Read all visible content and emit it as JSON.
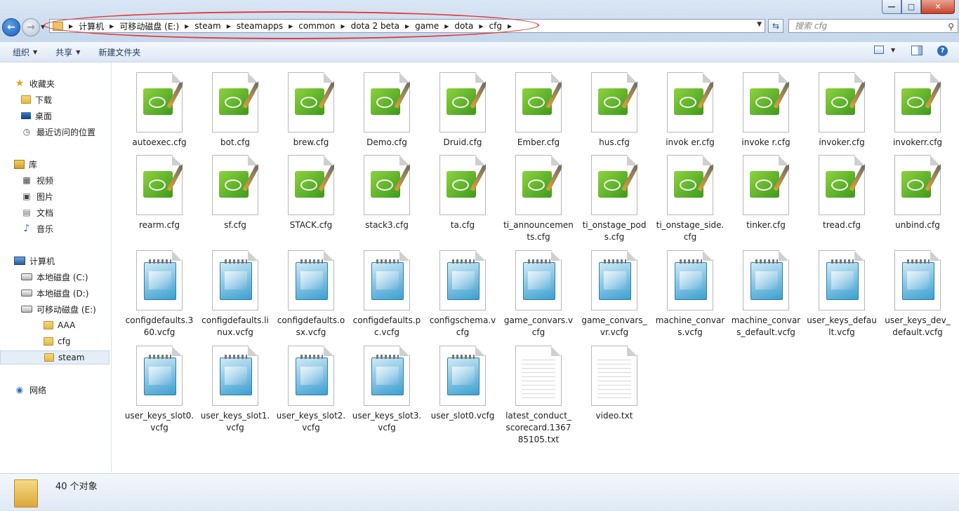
{
  "window": {
    "minimize_label": "—",
    "maximize_label": "□",
    "close_label": "✕"
  },
  "address": {
    "breadcrumbs": [
      "计算机",
      "可移动磁盘 (E:)",
      "steam",
      "steamapps",
      "common",
      "dota 2 beta",
      "game",
      "dota",
      "cfg"
    ]
  },
  "search": {
    "placeholder": "搜索 cfg"
  },
  "toolbar": {
    "organize_label": "组织",
    "share_label": "共享",
    "new_folder_label": "新建文件夹"
  },
  "sidebar": {
    "items": [
      {
        "label": "收藏夹",
        "icon": "star-icon",
        "level": 0
      },
      {
        "label": "下载",
        "icon": "download-folder-icon",
        "level": 1
      },
      {
        "label": "桌面",
        "icon": "desktop-icon",
        "level": 1
      },
      {
        "label": "最近访问的位置",
        "icon": "recent-places-icon",
        "level": 1
      },
      {
        "label": "库",
        "icon": "library-icon",
        "level": 0
      },
      {
        "label": "视频",
        "icon": "video-icon",
        "level": 1
      },
      {
        "label": "图片",
        "icon": "picture-icon",
        "level": 1
      },
      {
        "label": "文档",
        "icon": "document-icon",
        "level": 1
      },
      {
        "label": "音乐",
        "icon": "music-icon",
        "level": 1
      },
      {
        "label": "计算机",
        "icon": "computer-icon",
        "level": 0
      },
      {
        "label": "本地磁盘 (C:)",
        "icon": "system-drive-icon",
        "level": 1
      },
      {
        "label": "本地磁盘 (D:)",
        "icon": "drive-icon",
        "level": 1
      },
      {
        "label": "可移动磁盘 (E:)",
        "icon": "removable-drive-icon",
        "level": 1
      },
      {
        "label": "AAA",
        "icon": "folder-icon",
        "level": 2
      },
      {
        "label": "cfg",
        "icon": "folder-icon",
        "level": 2
      },
      {
        "label": "steam",
        "icon": "folder-icon",
        "level": 2,
        "selected": true
      },
      {
        "label": "网络",
        "icon": "network-icon",
        "level": 0
      }
    ]
  },
  "files": [
    {
      "name": "autoexec.cfg",
      "type": "cfg"
    },
    {
      "name": "bot.cfg",
      "type": "cfg"
    },
    {
      "name": "brew.cfg",
      "type": "cfg"
    },
    {
      "name": "Demo.cfg",
      "type": "cfg"
    },
    {
      "name": "Druid.cfg",
      "type": "cfg"
    },
    {
      "name": "Ember.cfg",
      "type": "cfg"
    },
    {
      "name": "hus.cfg",
      "type": "cfg"
    },
    {
      "name": "invok er.cfg",
      "type": "cfg"
    },
    {
      "name": "invoke r.cfg",
      "type": "cfg"
    },
    {
      "name": "invoker.cfg",
      "type": "cfg"
    },
    {
      "name": "invokerr.cfg",
      "type": "cfg"
    },
    {
      "name": "rearm.cfg",
      "type": "cfg"
    },
    {
      "name": "sf.cfg",
      "type": "cfg"
    },
    {
      "name": "STACK.cfg",
      "type": "cfg"
    },
    {
      "name": "stack3.cfg",
      "type": "cfg"
    },
    {
      "name": "ta.cfg",
      "type": "cfg"
    },
    {
      "name": "ti_announcements.cfg",
      "type": "cfg"
    },
    {
      "name": "ti_onstage_pods.cfg",
      "type": "cfg"
    },
    {
      "name": "ti_onstage_side.cfg",
      "type": "cfg"
    },
    {
      "name": "tinker.cfg",
      "type": "cfg"
    },
    {
      "name": "tread.cfg",
      "type": "cfg"
    },
    {
      "name": "unbind.cfg",
      "type": "cfg"
    },
    {
      "name": "configdefaults.360.vcfg",
      "type": "vcfg"
    },
    {
      "name": "configdefaults.linux.vcfg",
      "type": "vcfg"
    },
    {
      "name": "configdefaults.osx.vcfg",
      "type": "vcfg"
    },
    {
      "name": "configdefaults.pc.vcfg",
      "type": "vcfg"
    },
    {
      "name": "configschema.vcfg",
      "type": "vcfg"
    },
    {
      "name": "game_convars.vcfg",
      "type": "vcfg"
    },
    {
      "name": "game_convars_vr.vcfg",
      "type": "vcfg"
    },
    {
      "name": "machine_convars.vcfg",
      "type": "vcfg"
    },
    {
      "name": "machine_convars_default.vcfg",
      "type": "vcfg"
    },
    {
      "name": "user_keys_default.vcfg",
      "type": "vcfg"
    },
    {
      "name": "user_keys_dev_default.vcfg",
      "type": "vcfg"
    },
    {
      "name": "user_keys_slot0.vcfg",
      "type": "vcfg"
    },
    {
      "name": "user_keys_slot1.vcfg",
      "type": "vcfg"
    },
    {
      "name": "user_keys_slot2.vcfg",
      "type": "vcfg"
    },
    {
      "name": "user_keys_slot3.vcfg",
      "type": "vcfg"
    },
    {
      "name": "user_slot0.vcfg",
      "type": "vcfg"
    },
    {
      "name": "latest_conduct_scorecard.136785105.txt",
      "type": "txt"
    },
    {
      "name": "video.txt",
      "type": "txt"
    }
  ],
  "status": {
    "count_text": "40 个对象"
  },
  "colors": {
    "highlight_oval": "#e23b3b",
    "selection": "#e5edf7"
  }
}
